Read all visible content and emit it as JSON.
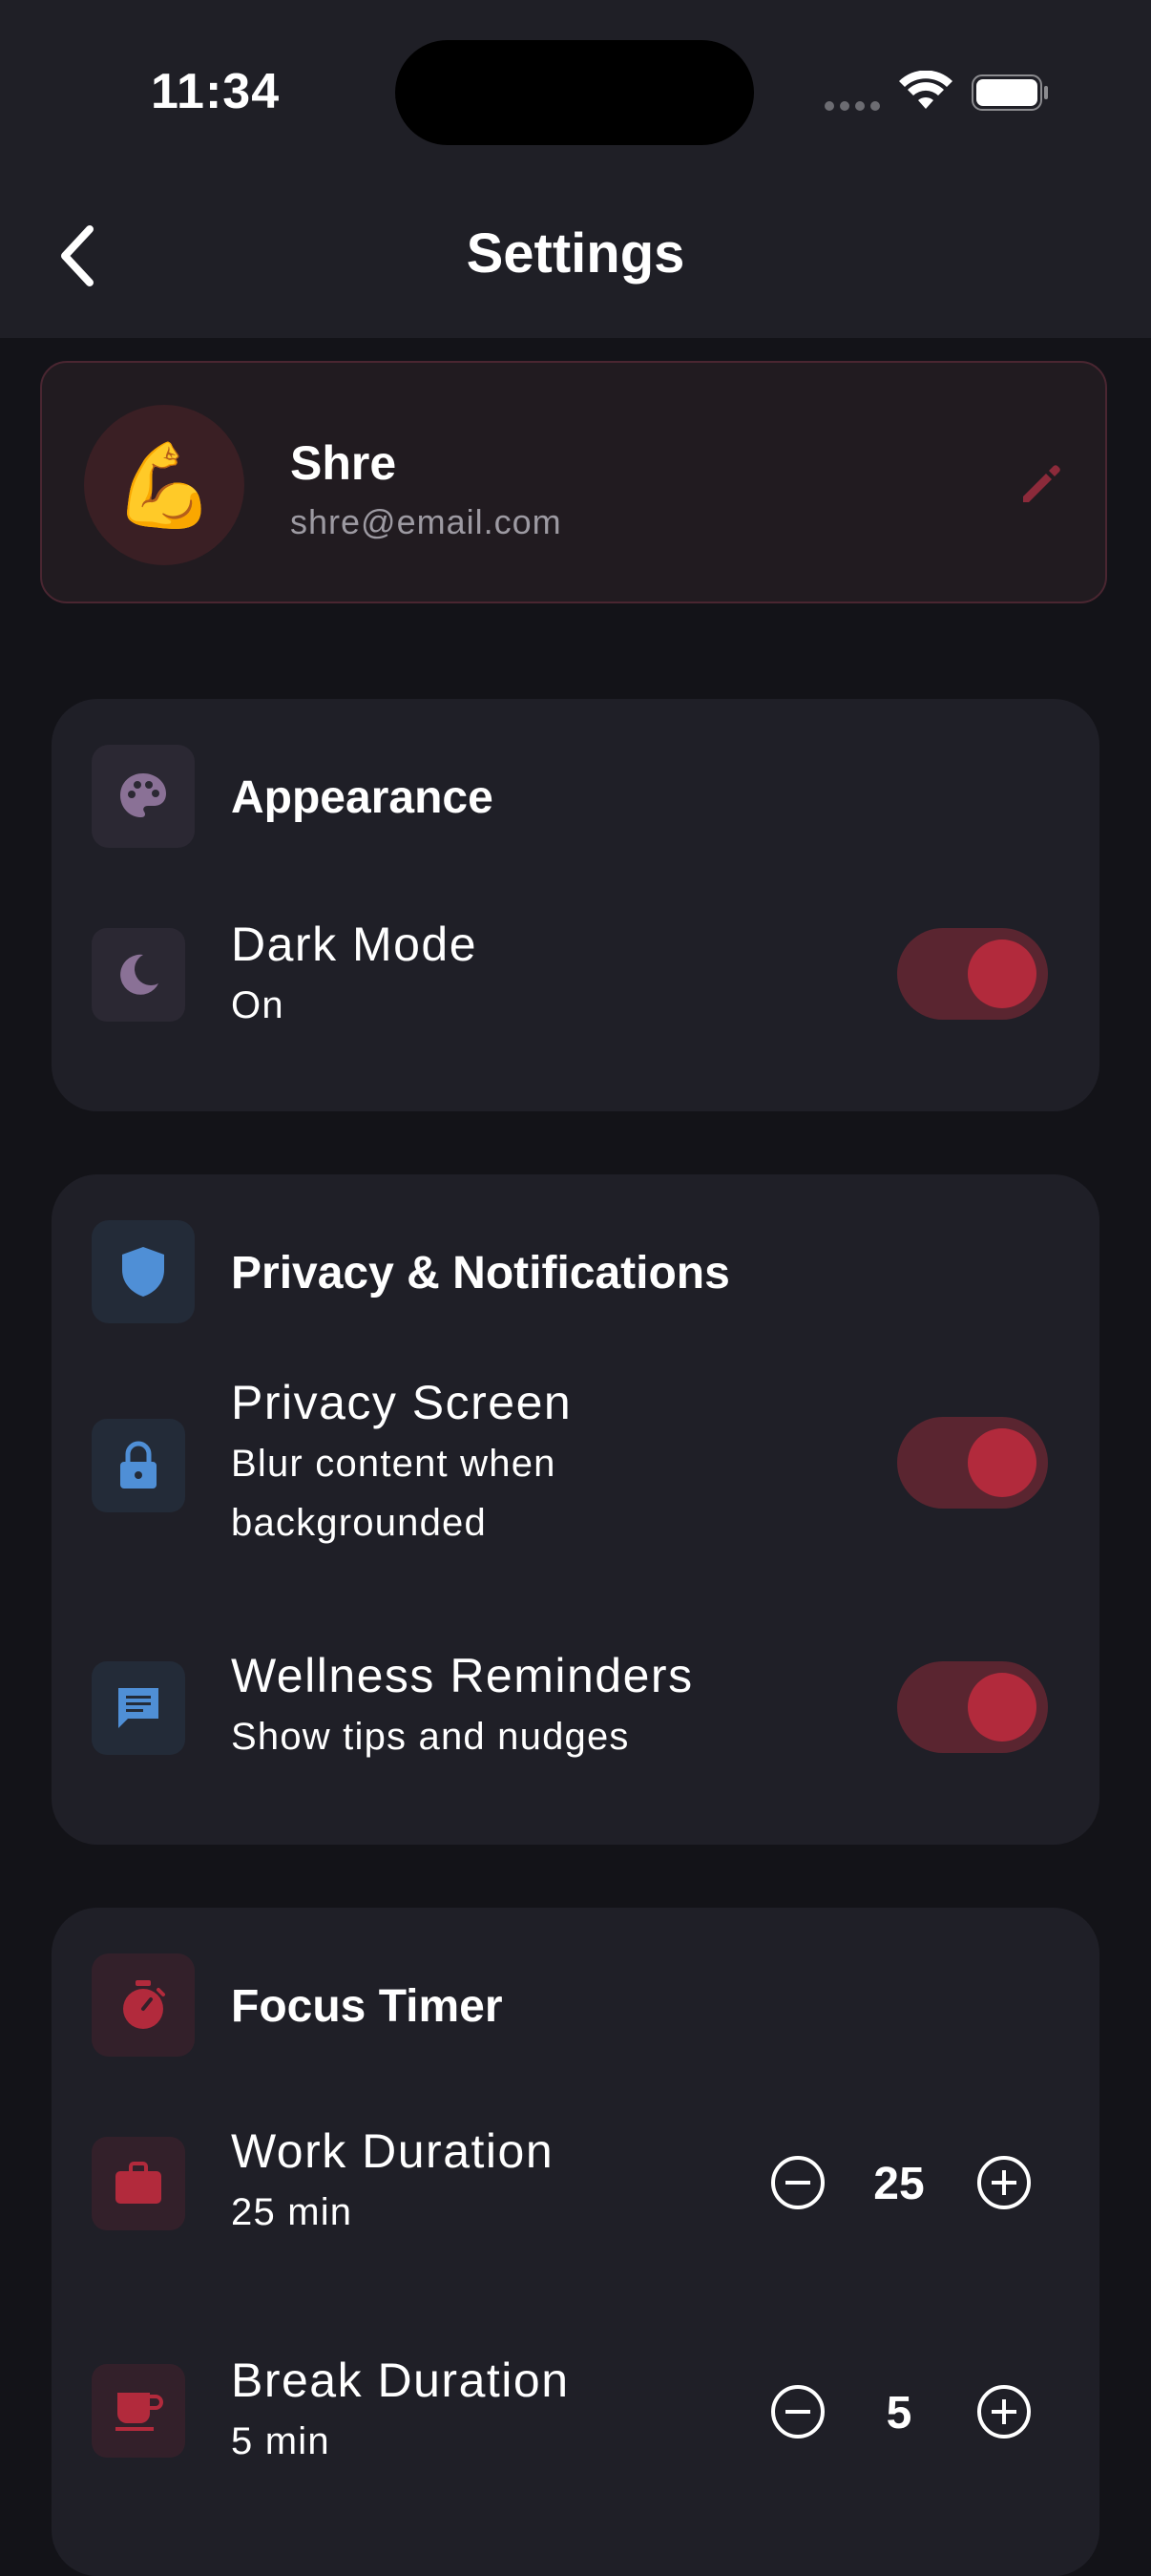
{
  "status_bar": {
    "time": "11:34"
  },
  "header": {
    "title": "Settings"
  },
  "profile": {
    "avatar_emoji": "💪",
    "name": "Shre",
    "email": "shre@email.com"
  },
  "appearance": {
    "title": "Appearance",
    "dark_mode": {
      "label": "Dark Mode",
      "status": "On",
      "enabled": true
    }
  },
  "privacy": {
    "title": "Privacy & Notifications",
    "privacy_screen": {
      "label": "Privacy Screen",
      "sub_line1": "Blur content when",
      "sub_line2": "backgrounded",
      "enabled": true
    },
    "wellness": {
      "label": "Wellness Reminders",
      "sub": "Show tips and nudges",
      "enabled": true
    }
  },
  "focus_timer": {
    "title": "Focus Timer",
    "work": {
      "label": "Work Duration",
      "sub": "25 min",
      "value": "25"
    },
    "break": {
      "label": "Break Duration",
      "sub": "5 min",
      "value": "5"
    }
  },
  "colors": {
    "accent": "#b22a3c",
    "toggle_track": "#5a2530",
    "purple_icon": "#8a7196",
    "blue_icon": "#4f8fd6",
    "red_icon": "#b22a3c"
  },
  "icons": [
    "chevron-left-icon",
    "palette-icon",
    "moon-icon",
    "shield-icon",
    "lock-icon",
    "chat-icon",
    "stopwatch-icon",
    "briefcase-icon",
    "coffee-icon",
    "pencil-icon",
    "minus-circle-icon",
    "plus-circle-icon",
    "wifi-icon",
    "battery-icon"
  ]
}
